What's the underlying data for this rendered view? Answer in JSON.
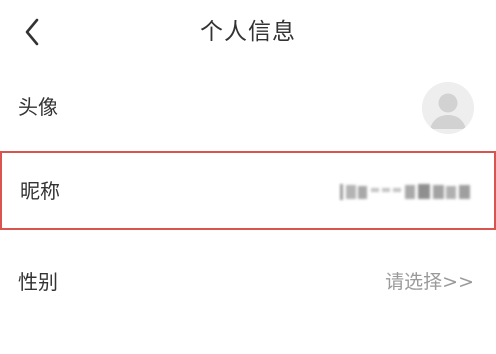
{
  "header": {
    "title": "个人信息",
    "back_icon": "chevron-left-icon"
  },
  "profile": {
    "avatar_label": "头像",
    "avatar_icon": "default-user-avatar-icon",
    "nickname_label": "昵称",
    "gender_label": "性别",
    "gender_value": "请选择>>"
  },
  "colors": {
    "highlight_border": "#d9534f",
    "placeholder_text": "#9a9a9a"
  }
}
